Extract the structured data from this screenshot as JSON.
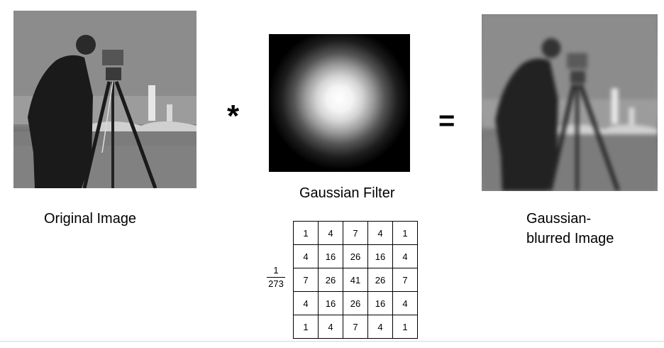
{
  "operators": {
    "convolve": "*",
    "equals": "="
  },
  "captions": {
    "original": "Original Image",
    "filter": "Gaussian Filter",
    "blurred_line1": "Gaussian-",
    "blurred_line2": "blurred Image"
  },
  "normalization": {
    "numerator": "1",
    "denominator": "273"
  },
  "kernel": [
    [
      "1",
      "4",
      "7",
      "4",
      "1"
    ],
    [
      "4",
      "16",
      "26",
      "16",
      "4"
    ],
    [
      "7",
      "26",
      "41",
      "26",
      "7"
    ],
    [
      "4",
      "16",
      "26",
      "16",
      "4"
    ],
    [
      "1",
      "4",
      "7",
      "4",
      "1"
    ]
  ]
}
